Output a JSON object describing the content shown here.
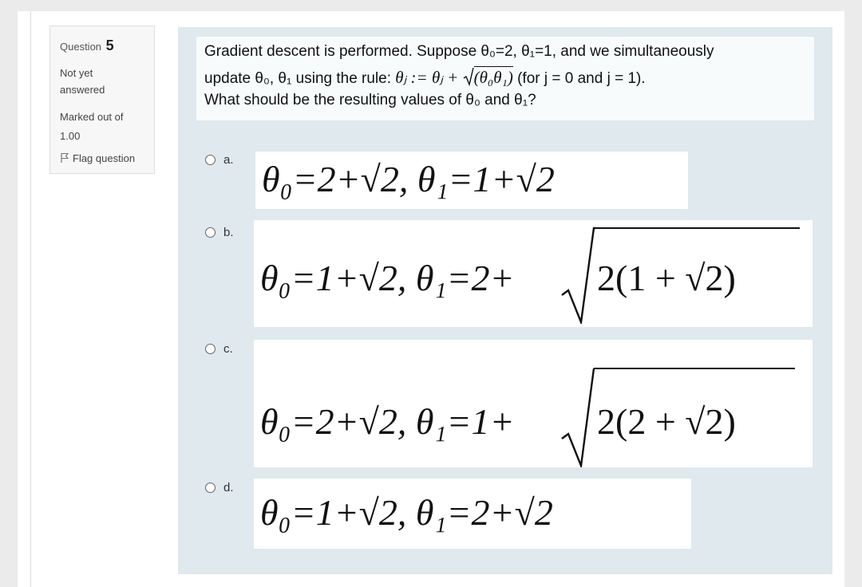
{
  "info": {
    "question_label": "Question",
    "question_number": "5",
    "state_line1": "Not yet",
    "state_line2": "answered",
    "marks_line1": "Marked out of",
    "marks_line2": "1.00",
    "flag_label": "Flag question"
  },
  "question": {
    "line1": "Gradient descent is performed. Suppose θ₀=2, θ₁=1, and we simultaneously",
    "line2_pre": "update θ₀, θ₁ using the rule: ",
    "line2_rule_lhs": "θⱼ := θⱼ + ",
    "line2_rule_rad": "(θ₀θ₁)",
    "line2_post": " (for j = 0 and j = 1).",
    "line3": "What should be the resulting values of θ₀ and θ₁?"
  },
  "options": [
    {
      "letter": "a.",
      "expr": "θ₀=2+√2, θ₁=1+√2"
    },
    {
      "letter": "b.",
      "expr_pre": "θ₀=1+√2, θ₁=2+",
      "expr_rad": "2(1 + √2)"
    },
    {
      "letter": "c.",
      "expr_pre": "θ₀=2+√2, θ₁=1+",
      "expr_rad": "2(2 + √2)"
    },
    {
      "letter": "d.",
      "expr": "θ₀=1+√2, θ₁=2+√2"
    }
  ]
}
